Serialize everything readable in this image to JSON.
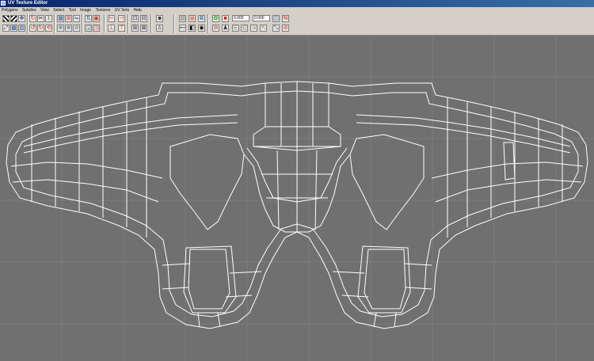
{
  "window": {
    "title": "UV Texture Editor"
  },
  "menu": [
    "Polygons",
    "Subdivs",
    "View",
    "Select",
    "Tool",
    "Image",
    "Textures",
    "UV Sets",
    "Help"
  ],
  "toolbar": {
    "field_u_value": "0.000",
    "field_v_value": "0.000",
    "icons_row1": [
      "checker-icon",
      "checker2-icon",
      "move-icon",
      "rotate-icon",
      "cut-icon",
      "sew-icon",
      "layout-icon",
      "grid-icon",
      "flip-h-icon",
      "flip-v-icon",
      "snapshot-icon",
      "align-icon",
      "image-icon",
      "dim-icon",
      "shade-icon",
      "pixel-snap-icon",
      "texture-icon",
      "swatch-icon"
    ],
    "icons_row2": [
      "unfold-icon",
      "relax-icon",
      "rotate-ccw-icon",
      "rotate-cw-icon",
      "cycle-icon",
      "stitch-icon",
      "normalize-icon",
      "split-icon",
      "align-left-icon",
      "align-bottom-icon",
      "layout2-icon",
      "grid2-icon",
      "person-icon",
      "isolate-icon",
      "uv-shell-icon",
      "select-uv-icon",
      "copy-icon",
      "paste-icon",
      "paste-u-icon",
      "paste-v-icon",
      "scale-icon",
      "stop-icon"
    ]
  },
  "colors": {
    "canvas_bg": "#707070",
    "grid": "#7c7c7c",
    "wire": "#ffffff"
  }
}
